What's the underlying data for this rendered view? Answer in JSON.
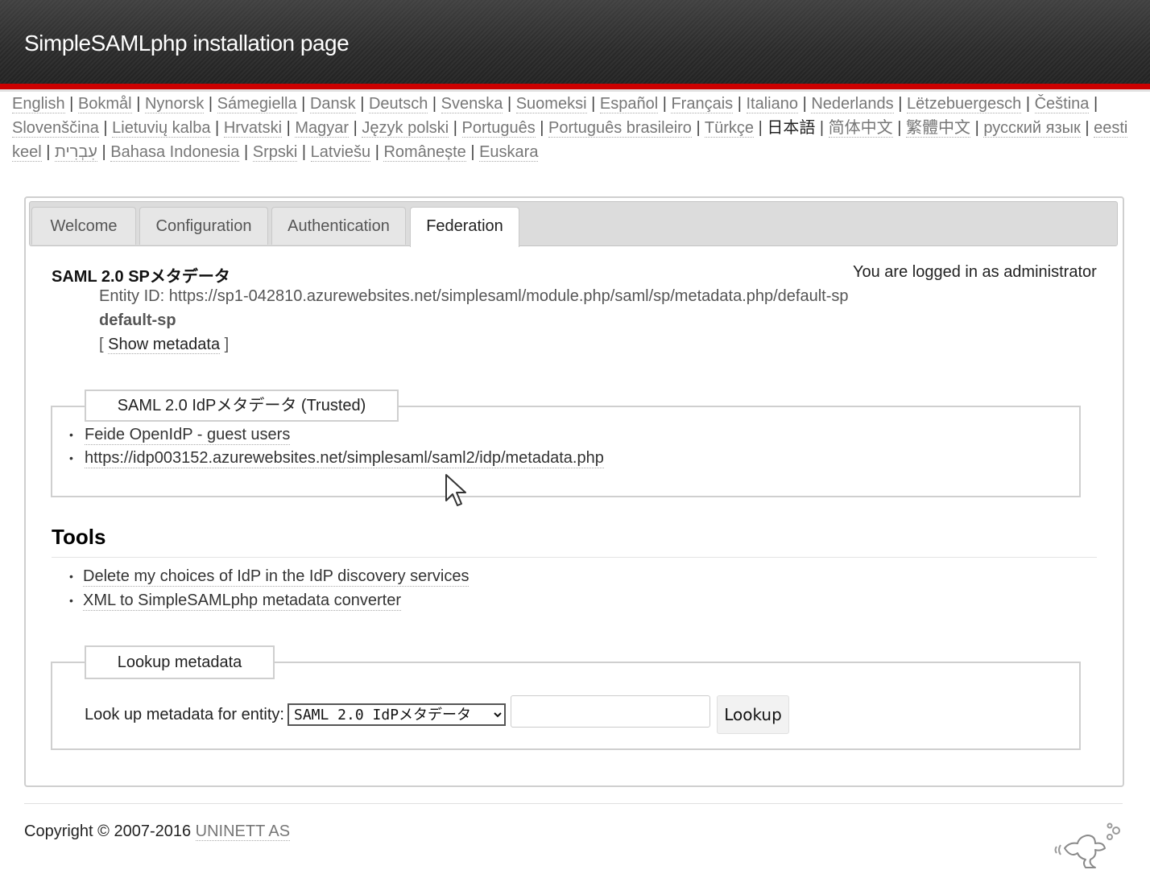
{
  "header": {
    "title": "SimpleSAMLphp installation page"
  },
  "languages": [
    {
      "label": "English",
      "current": false
    },
    {
      "label": "Bokmål",
      "current": false
    },
    {
      "label": "Nynorsk",
      "current": false
    },
    {
      "label": "Sámegiella",
      "current": false
    },
    {
      "label": "Dansk",
      "current": false
    },
    {
      "label": "Deutsch",
      "current": false
    },
    {
      "label": "Svenska",
      "current": false
    },
    {
      "label": "Suomeksi",
      "current": false
    },
    {
      "label": "Español",
      "current": false
    },
    {
      "label": "Français",
      "current": false
    },
    {
      "label": "Italiano",
      "current": false
    },
    {
      "label": "Nederlands",
      "current": false
    },
    {
      "label": "Lëtzebuergesch",
      "current": false
    },
    {
      "label": "Čeština",
      "current": false
    },
    {
      "label": "Slovenščina",
      "current": false
    },
    {
      "label": "Lietuvių kalba",
      "current": false
    },
    {
      "label": "Hrvatski",
      "current": false
    },
    {
      "label": "Magyar",
      "current": false
    },
    {
      "label": "Język polski",
      "current": false
    },
    {
      "label": "Português",
      "current": false
    },
    {
      "label": "Português brasileiro",
      "current": false
    },
    {
      "label": "Türkçe",
      "current": false
    },
    {
      "label": "日本語",
      "current": true
    },
    {
      "label": "简体中文",
      "current": false
    },
    {
      "label": "繁體中文",
      "current": false
    },
    {
      "label": "русский язык",
      "current": false
    },
    {
      "label": "eesti keel",
      "current": false
    },
    {
      "label": "עִבְרִית",
      "current": false
    },
    {
      "label": "Bahasa Indonesia",
      "current": false
    },
    {
      "label": "Srpski",
      "current": false
    },
    {
      "label": "Latviešu",
      "current": false
    },
    {
      "label": "Românește",
      "current": false
    },
    {
      "label": "Euskara",
      "current": false
    }
  ],
  "language_separator": "|",
  "tabs": [
    {
      "label": "Welcome",
      "active": false
    },
    {
      "label": "Configuration",
      "active": false
    },
    {
      "label": "Authentication",
      "active": false
    },
    {
      "label": "Federation",
      "active": true
    }
  ],
  "federation": {
    "sp_heading": "SAML 2.0 SPメタデータ",
    "logged_in": "You are logged in as administrator",
    "entity_id_label": "Entity ID:",
    "entity_id": "https://sp1-042810.azurewebsites.net/simplesaml/module.php/saml/sp/metadata.php/default-sp",
    "sp_name": "default-sp",
    "bracket_open": "[",
    "show_metadata": "Show metadata",
    "bracket_close": "]",
    "idp_legend": "SAML 2.0 IdPメタデータ (Trusted)",
    "idp_items": [
      "Feide OpenIdP - guest users",
      "https://idp003152.azurewebsites.net/simplesaml/saml2/idp/metadata.php"
    ]
  },
  "tools": {
    "title": "Tools",
    "items": [
      "Delete my choices of IdP in the IdP discovery services",
      "XML to SimpleSAMLphp metadata converter"
    ]
  },
  "lookup": {
    "legend": "Lookup metadata",
    "label": "Look up metadata for entity:",
    "selected": "SAML 2.0 IdPメタデータ",
    "input_value": "",
    "button": "Lookup"
  },
  "footer": {
    "copyright": "Copyright © 2007-2016",
    "company": "UNINETT AS"
  },
  "bullet_char": "•"
}
